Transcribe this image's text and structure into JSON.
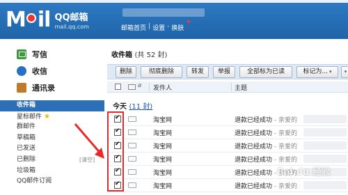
{
  "header": {
    "logo_m": "M",
    "logo_il": "il",
    "brand": "QQ邮箱",
    "url": "mail.qq.com",
    "links": [
      "邮箱首页",
      "设置",
      "换肤"
    ],
    "separator": "|",
    "separator2": "-",
    "accent": "#2e7bc4"
  },
  "sidebar": {
    "primary": [
      {
        "label": "写信",
        "icon": "compose-icon"
      },
      {
        "label": "收信",
        "icon": "inbox-icon"
      },
      {
        "label": "通讯录",
        "icon": "contacts-icon"
      }
    ],
    "folders": [
      {
        "label": "收件箱",
        "active": true
      },
      {
        "label": "星标邮件",
        "star": "★"
      },
      {
        "label": "群邮件"
      },
      {
        "label": "草稿箱"
      },
      {
        "label": "已发送"
      },
      {
        "label": "已删除",
        "extra": "[清空]"
      },
      {
        "label": "垃圾箱"
      },
      {
        "label": "QQ邮件订阅"
      }
    ]
  },
  "main": {
    "title": "收件箱",
    "count": "(共 52 封)",
    "toolbar": {
      "delete": "删除",
      "perm_delete": "彻底删除",
      "forward": "转发",
      "report": "举报",
      "mark_all_read": "全部标为已读",
      "mark_as": "标记为...",
      "more_caret": "▾",
      "extra_caret": "▾"
    },
    "columns": {
      "clip": "⌀",
      "sender": "发件人",
      "subject": "主题"
    },
    "group": {
      "label": "今天",
      "count": "(11 封)"
    },
    "rows": [
      {
        "sender": "淘宝网",
        "subject": "退款已经成功",
        "preview": " - 亲爱的"
      },
      {
        "sender": "淘宝网",
        "subject": "退款已经成功",
        "preview": " - 亲爱的"
      },
      {
        "sender": "淘宝网",
        "subject": "退款已经成功",
        "preview": " - 亲爱的"
      },
      {
        "sender": "淘宝网",
        "subject": "退款已经成功",
        "preview": " - 亲爱的"
      },
      {
        "sender": "淘宝网",
        "subject": "退款已经成功",
        "preview": " - 亲爱的"
      },
      {
        "sender": "淘宝网",
        "subject": "退款已经成功",
        "preview": " - 亲爱的"
      }
    ]
  },
  "watermark": "Bai du 经验"
}
